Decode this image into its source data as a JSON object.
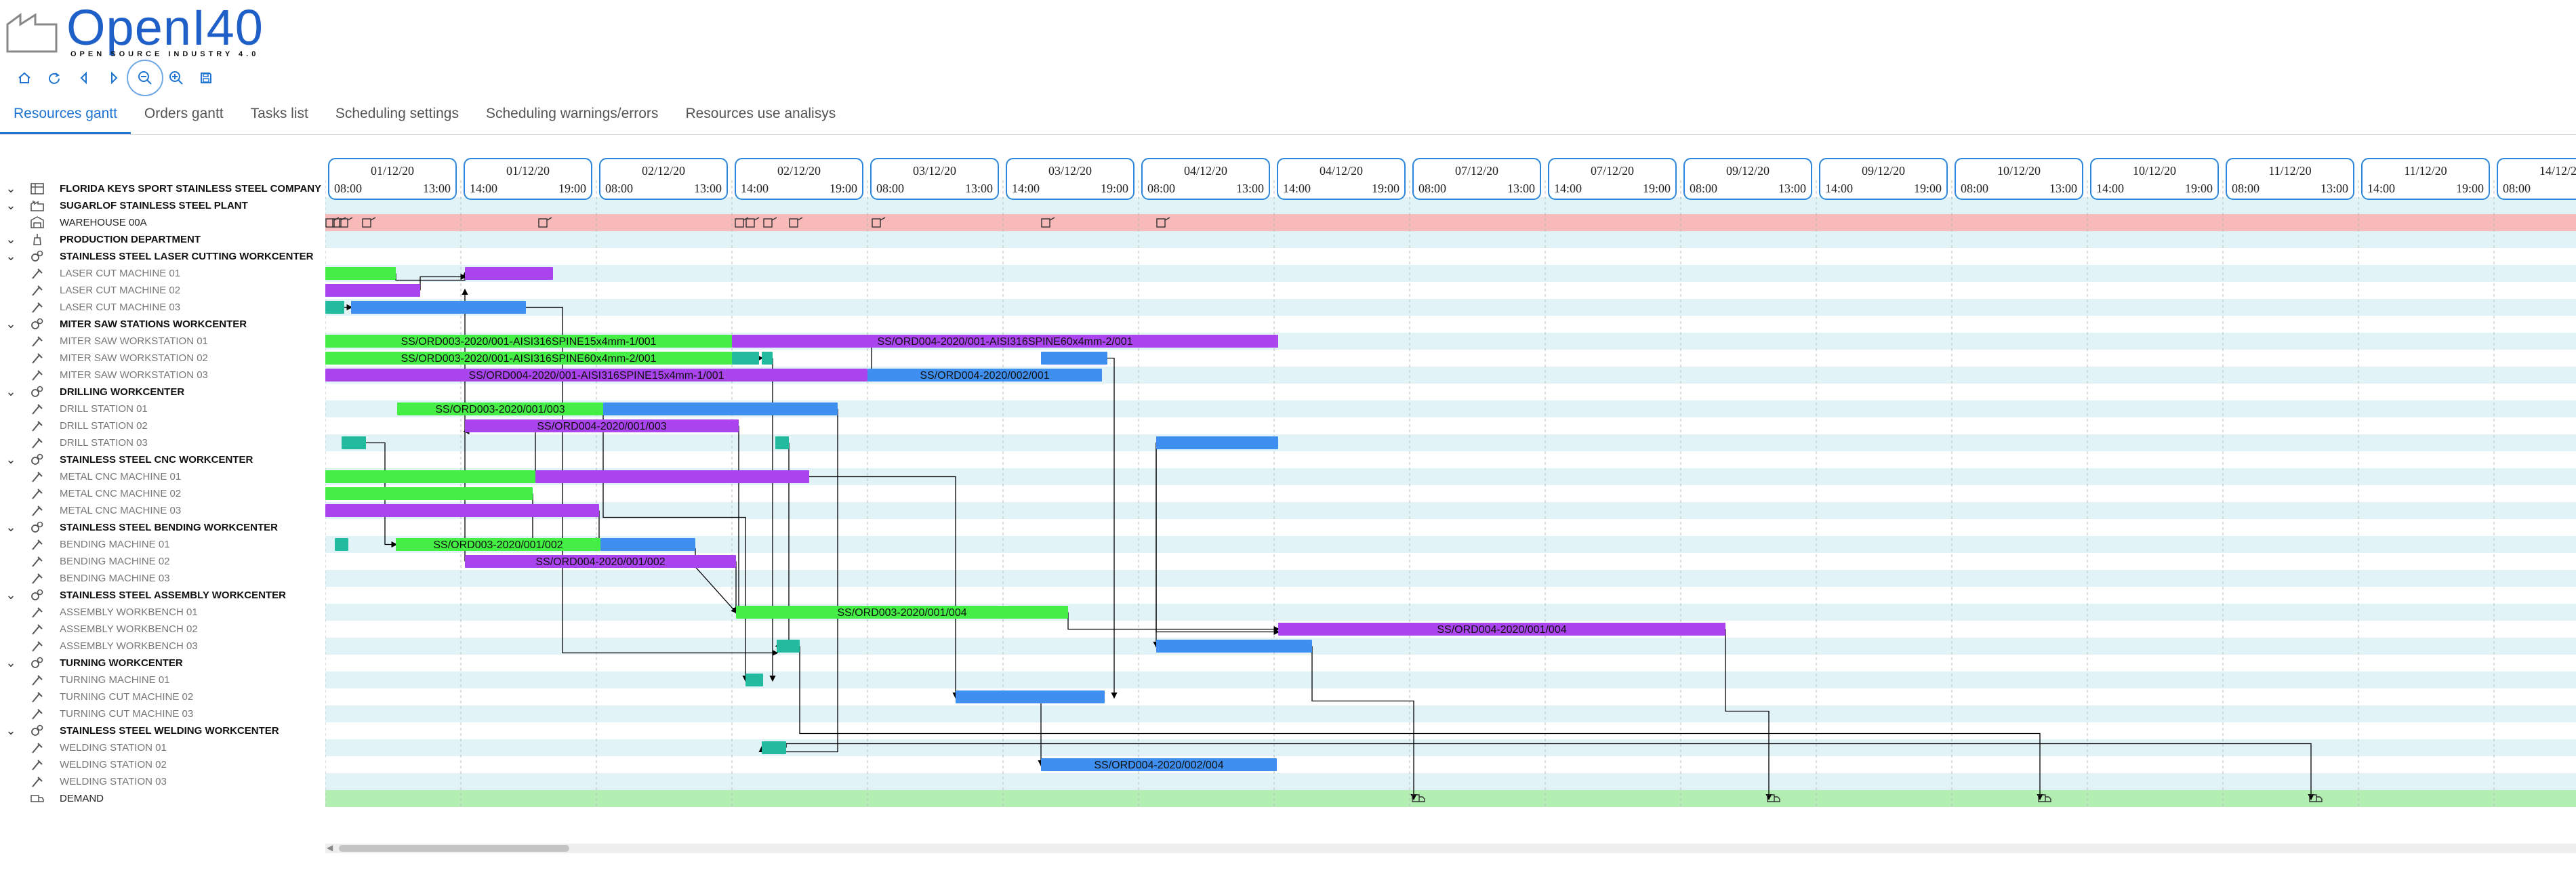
{
  "app": {
    "logo_text": "OpenI40",
    "logo_subtext": "OPEN SOURCE INDUSTRY 4.0"
  },
  "toolbar": [
    {
      "icon": "home-icon"
    },
    {
      "icon": "refresh-icon"
    },
    {
      "icon": "chevron-left-icon"
    },
    {
      "icon": "chevron-right-icon"
    },
    {
      "icon": "zoom-out-icon",
      "active": true
    },
    {
      "icon": "zoom-in-icon"
    },
    {
      "icon": "save-icon"
    }
  ],
  "tabs": [
    {
      "label": "Resources gantt",
      "active": true
    },
    {
      "label": "Orders gantt"
    },
    {
      "label": "Tasks list"
    },
    {
      "label": "Scheduling settings"
    },
    {
      "label": "Scheduling warnings/errors"
    },
    {
      "label": "Resources use analisys"
    }
  ],
  "timeline": [
    {
      "date": "01/12/20",
      "start": "08:00",
      "end": "13:00"
    },
    {
      "date": "01/12/20",
      "start": "14:00",
      "end": "19:00"
    },
    {
      "date": "02/12/20",
      "start": "08:00",
      "end": "13:00"
    },
    {
      "date": "02/12/20",
      "start": "14:00",
      "end": "19:00"
    },
    {
      "date": "03/12/20",
      "start": "08:00",
      "end": "13:00"
    },
    {
      "date": "03/12/20",
      "start": "14:00",
      "end": "19:00"
    },
    {
      "date": "04/12/20",
      "start": "08:00",
      "end": "13:00"
    },
    {
      "date": "04/12/20",
      "start": "14:00",
      "end": "19:00"
    },
    {
      "date": "07/12/20",
      "start": "08:00",
      "end": "13:00"
    },
    {
      "date": "07/12/20",
      "start": "14:00",
      "end": "19:00"
    },
    {
      "date": "09/12/20",
      "start": "08:00",
      "end": "13:00"
    },
    {
      "date": "09/12/20",
      "start": "14:00",
      "end": "19:00"
    },
    {
      "date": "10/12/20",
      "start": "08:00",
      "end": "13:00"
    },
    {
      "date": "10/12/20",
      "start": "14:00",
      "end": "19:00"
    },
    {
      "date": "11/12/20",
      "start": "08:00",
      "end": "13:00"
    },
    {
      "date": "11/12/20",
      "start": "14:00",
      "end": "19:00"
    },
    {
      "date": "14/12/20",
      "start": "08:00",
      "end": ""
    }
  ],
  "resources": [
    {
      "label": "FLORIDA KEYS SPORT STAINLESS STEEL COMPANY",
      "kind": "company",
      "chevron": true
    },
    {
      "label": "SUGARLOF STAINLESS STEEL PLANT",
      "kind": "plant",
      "chevron": true
    },
    {
      "label": "WAREHOUSE 00A",
      "kind": "warehouse"
    },
    {
      "label": "PRODUCTION DEPARTMENT",
      "kind": "department",
      "chevron": true
    },
    {
      "label": "STAINLESS STEEL LASER CUTTING WORKCENTER",
      "kind": "workcenter",
      "chevron": true
    },
    {
      "label": "LASER CUT MACHINE 01",
      "kind": "machine"
    },
    {
      "label": "LASER CUT MACHINE 02",
      "kind": "machine"
    },
    {
      "label": "LASER CUT MACHINE 03",
      "kind": "machine"
    },
    {
      "label": "MITER SAW STATIONS WORKCENTER",
      "kind": "workcenter",
      "chevron": true
    },
    {
      "label": "MITER SAW WORKSTATION 01",
      "kind": "machine"
    },
    {
      "label": "MITER SAW WORKSTATION 02",
      "kind": "machine"
    },
    {
      "label": "MITER SAW WORKSTATION 03",
      "kind": "machine"
    },
    {
      "label": "DRILLING WORKCENTER",
      "kind": "workcenter",
      "chevron": true
    },
    {
      "label": "DRILL STATION 01",
      "kind": "machine"
    },
    {
      "label": "DRILL STATION 02",
      "kind": "machine"
    },
    {
      "label": "DRILL STATION 03",
      "kind": "machine"
    },
    {
      "label": "STAINLESS STEEL CNC WORKCENTER",
      "kind": "workcenter",
      "chevron": true
    },
    {
      "label": "METAL CNC MACHINE 01",
      "kind": "machine"
    },
    {
      "label": "METAL CNC MACHINE 02",
      "kind": "machine"
    },
    {
      "label": "METAL CNC MACHINE 03",
      "kind": "machine"
    },
    {
      "label": "STAINLESS STEEL BENDING WORKCENTER",
      "kind": "workcenter",
      "chevron": true
    },
    {
      "label": "BENDING MACHINE 01",
      "kind": "machine"
    },
    {
      "label": "BENDING MACHINE 02",
      "kind": "machine"
    },
    {
      "label": "BENDING MACHINE 03",
      "kind": "machine"
    },
    {
      "label": "STAINLESS STEEL ASSEMBLY WORKCENTER",
      "kind": "workcenter",
      "chevron": true
    },
    {
      "label": "ASSEMBLY WORKBENCH 01",
      "kind": "machine"
    },
    {
      "label": "ASSEMBLY WORKBENCH 02",
      "kind": "machine"
    },
    {
      "label": "ASSEMBLY WORKBENCH 03",
      "kind": "machine"
    },
    {
      "label": "TURNING WORKCENTER",
      "kind": "workcenter",
      "chevron": true
    },
    {
      "label": "TURNING MACHINE 01",
      "kind": "machine"
    },
    {
      "label": "TURNING CUT MACHINE 02",
      "kind": "machine"
    },
    {
      "label": "TURNING CUT MACHINE 03",
      "kind": "machine"
    },
    {
      "label": "STAINLESS STEEL WELDING WORKCENTER",
      "kind": "workcenter",
      "chevron": true
    },
    {
      "label": "WELDING STATION 01",
      "kind": "machine"
    },
    {
      "label": "WELDING STATION 02",
      "kind": "machine"
    },
    {
      "label": "WELDING STATION 03",
      "kind": "machine"
    },
    {
      "label": "DEMAND",
      "kind": "demand"
    }
  ],
  "colors": {
    "order003": "#44ee44",
    "order004": "#aa44ee",
    "order002": "#3f8ff0",
    "short": "#22bba0",
    "warehouse": "#f8b9b9",
    "demand": "#b3efb3",
    "stripe": "#e2f3f8",
    "accent": "#1e74d0"
  },
  "tasks": [
    {
      "row": 5,
      "start": 0.0,
      "end": 0.52,
      "color": "order003",
      "label": ""
    },
    {
      "row": 5,
      "start": 1.03,
      "end": 1.68,
      "color": "order004",
      "label": ""
    },
    {
      "row": 6,
      "start": 0.0,
      "end": 0.7,
      "color": "order004",
      "label": ""
    },
    {
      "row": 7,
      "start": 0.0,
      "end": 0.14,
      "color": "short",
      "label": ""
    },
    {
      "row": 7,
      "start": 0.19,
      "end": 1.48,
      "color": "order002",
      "label": ""
    },
    {
      "row": 9,
      "start": 0.0,
      "end": 3.0,
      "color": "order003",
      "label": "SS/ORD003-2020/001-AISI316SPINE15x4mm-1/001"
    },
    {
      "row": 9,
      "start": 3.0,
      "end": 7.03,
      "color": "order004",
      "label": "SS/ORD004-2020/001-AISI316SPINE60x4mm-2/001"
    },
    {
      "row": 10,
      "start": 0.0,
      "end": 3.0,
      "color": "order003",
      "label": "SS/ORD003-2020/001-AISI316SPINE60x4mm-2/001"
    },
    {
      "row": 10,
      "start": 3.0,
      "end": 3.2,
      "color": "short",
      "label": ""
    },
    {
      "row": 10,
      "start": 3.22,
      "end": 3.3,
      "color": "short",
      "label": ""
    },
    {
      "row": 10,
      "start": 5.28,
      "end": 5.77,
      "color": "order002",
      "label": ""
    },
    {
      "row": 11,
      "start": 0.0,
      "end": 4.0,
      "color": "order004",
      "label": "SS/ORD004-2020/001-AISI316SPINE15x4mm-1/001"
    },
    {
      "row": 11,
      "start": 4.0,
      "end": 5.73,
      "color": "order002",
      "label": "SS/ORD004-2020/002/001"
    },
    {
      "row": 13,
      "start": 0.53,
      "end": 2.05,
      "color": "order003",
      "label": "SS/ORD003-2020/001/003"
    },
    {
      "row": 13,
      "start": 2.05,
      "end": 3.78,
      "color": "order002",
      "label": ""
    },
    {
      "row": 14,
      "start": 1.03,
      "end": 3.05,
      "color": "order004",
      "label": "SS/ORD004-2020/001/003"
    },
    {
      "row": 15,
      "start": 0.12,
      "end": 0.3,
      "color": "short",
      "label": ""
    },
    {
      "row": 15,
      "start": 3.32,
      "end": 3.42,
      "color": "short",
      "label": ""
    },
    {
      "row": 15,
      "start": 6.13,
      "end": 7.03,
      "color": "order002",
      "label": ""
    },
    {
      "row": 17,
      "start": 0.0,
      "end": 1.55,
      "color": "order003",
      "label": ""
    },
    {
      "row": 17,
      "start": 1.55,
      "end": 3.57,
      "color": "order004",
      "label": ""
    },
    {
      "row": 18,
      "start": 0.0,
      "end": 1.53,
      "color": "order003",
      "label": ""
    },
    {
      "row": 19,
      "start": 0.0,
      "end": 2.02,
      "color": "order004",
      "label": ""
    },
    {
      "row": 21,
      "start": 0.07,
      "end": 0.17,
      "color": "short",
      "label": ""
    },
    {
      "row": 21,
      "start": 0.52,
      "end": 2.03,
      "color": "order003",
      "label": "SS/ORD003-2020/001/002"
    },
    {
      "row": 21,
      "start": 2.03,
      "end": 2.73,
      "color": "order002",
      "label": ""
    },
    {
      "row": 22,
      "start": 1.03,
      "end": 3.03,
      "color": "order004",
      "label": "SS/ORD004-2020/001/002"
    },
    {
      "row": 25,
      "start": 3.03,
      "end": 5.48,
      "color": "order003",
      "label": "SS/ORD003-2020/001/004"
    },
    {
      "row": 26,
      "start": 7.03,
      "end": 10.33,
      "color": "order004",
      "label": "SS/ORD004-2020/001/004"
    },
    {
      "row": 27,
      "start": 3.33,
      "end": 3.5,
      "color": "short",
      "label": ""
    },
    {
      "row": 27,
      "start": 6.13,
      "end": 7.28,
      "color": "order002",
      "label": ""
    },
    {
      "row": 29,
      "start": 3.1,
      "end": 3.23,
      "color": "short",
      "label": ""
    },
    {
      "row": 30,
      "start": 4.65,
      "end": 5.75,
      "color": "order002",
      "label": ""
    },
    {
      "row": 33,
      "start": 3.22,
      "end": 3.4,
      "color": "short",
      "label": ""
    },
    {
      "row": 34,
      "start": 5.28,
      "end": 7.02,
      "color": "order002",
      "label": "SS/ORD004-2020/002/004"
    }
  ],
  "warehouse_markers": [
    0.0,
    0.05,
    0.1,
    0.27,
    1.57,
    3.02,
    3.1,
    3.23,
    3.42,
    4.03,
    5.28,
    6.13
  ],
  "demand_markers": [
    8.03,
    10.65,
    12.65,
    14.65
  ]
}
